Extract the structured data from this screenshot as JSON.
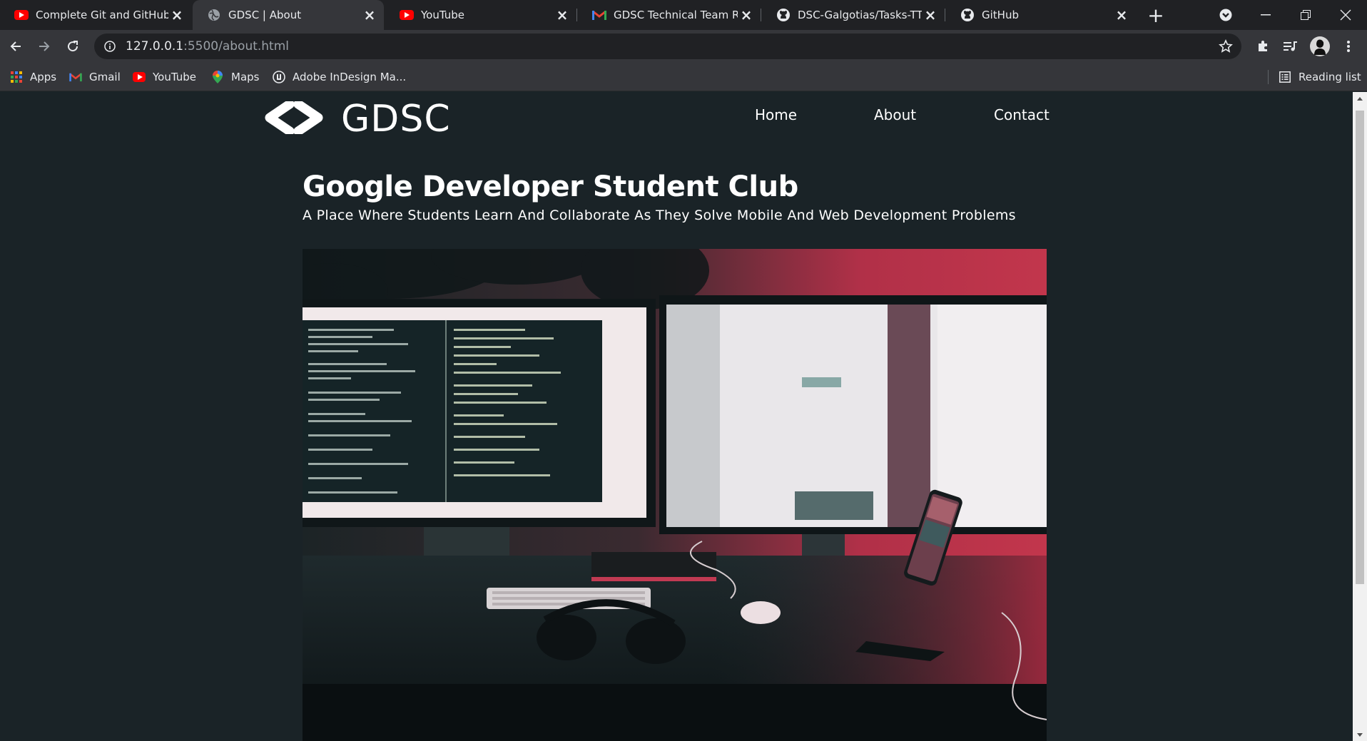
{
  "browser": {
    "tabs": [
      {
        "title": "Complete Git and GitHub Tu",
        "icon": "youtube-icon"
      },
      {
        "title": "GDSC | About",
        "icon": "globe-icon",
        "active": true
      },
      {
        "title": "YouTube",
        "icon": "youtube-icon"
      },
      {
        "title": "GDSC Technical Team Roun",
        "icon": "gmail-icon"
      },
      {
        "title": "DSC-Galgotias/Tasks-TT_GD",
        "icon": "github-icon"
      },
      {
        "title": "GitHub",
        "icon": "github-icon"
      }
    ],
    "url_host": "127.0.0.1",
    "url_rest": ":5500/about.html",
    "bookmarks": [
      {
        "label": "Apps",
        "icon": "apps-grid-icon"
      },
      {
        "label": "Gmail",
        "icon": "gmail-icon"
      },
      {
        "label": "YouTube",
        "icon": "youtube-icon"
      },
      {
        "label": "Maps",
        "icon": "maps-pin-icon"
      },
      {
        "label": "Adobe InDesign Ma...",
        "icon": "adobe-icon"
      }
    ],
    "reading_list": "Reading list"
  },
  "page": {
    "logo_text": "GDSC",
    "nav": [
      "Home",
      "About",
      "Contact"
    ],
    "title": "Google Developer Student Club",
    "subtitle": "A Place Where Students Learn And Collaborate As They Solve Mobile And Web Development Problems"
  },
  "colors": {
    "page_bg": "#1a2327",
    "tabstrip": "#202124",
    "toolbar": "#35363a",
    "text": "#ffffff",
    "photo_accent": "#c2364c"
  }
}
